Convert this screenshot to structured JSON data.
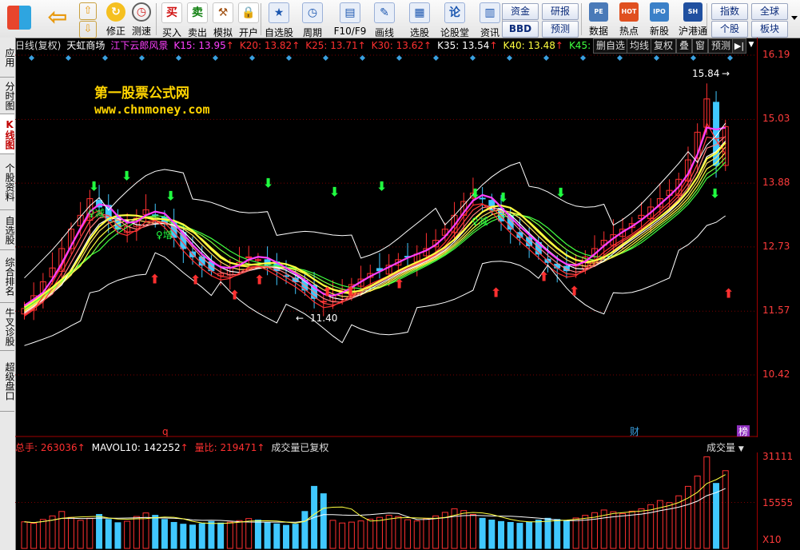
{
  "toolbar": {
    "nav": [
      {
        "label": "修正",
        "icon": "refresh-icon"
      },
      {
        "label": "测速",
        "icon": "clock-icon"
      }
    ],
    "trade": [
      {
        "label": "买入",
        "glyph": "买",
        "color": "#d01010"
      },
      {
        "label": "卖出",
        "glyph": "卖",
        "color": "#108010"
      },
      {
        "label": "模拟",
        "glyph": "⚒",
        "color": "#a05010"
      },
      {
        "label": "开户",
        "glyph": "🔒",
        "color": "#706040"
      }
    ],
    "tools": [
      {
        "label": "自选股",
        "glyph": "★"
      },
      {
        "label": "周期",
        "glyph": "◷"
      },
      {
        "label": "F10/F9",
        "glyph": "▤"
      },
      {
        "label": "画线",
        "glyph": "✎"
      },
      {
        "label": "选股",
        "glyph": "▦"
      },
      {
        "label": "论股堂",
        "glyph": "论"
      },
      {
        "label": "资讯",
        "glyph": "▥"
      }
    ],
    "buttons_mid": [
      {
        "label": "资金"
      },
      {
        "label": "研报"
      },
      {
        "label": "BBD"
      },
      {
        "label": "预测"
      }
    ],
    "apps": [
      {
        "label": "数据",
        "glyph": "PE"
      },
      {
        "label": "热点",
        "glyph": "HOT"
      },
      {
        "label": "新股",
        "glyph": "IPO"
      },
      {
        "label": "沪港通",
        "glyph": "SH"
      }
    ],
    "buttons_right": [
      {
        "label": "指数"
      },
      {
        "label": "全球"
      },
      {
        "label": "个股"
      },
      {
        "label": "板块"
      }
    ]
  },
  "left_tabs": [
    {
      "label": "应用",
      "active": false
    },
    {
      "label": "分时图",
      "active": false
    },
    {
      "label": "K线图",
      "active": true
    },
    {
      "label": "个股资料",
      "active": false
    },
    {
      "label": "自选股",
      "active": false
    },
    {
      "label": "综合排名",
      "active": false
    },
    {
      "label": "牛叉诊股",
      "active": false
    },
    {
      "label": "超级盘口",
      "active": false
    }
  ],
  "chart_header": {
    "period": "日线(复权)",
    "stock": "天虹商场",
    "indicator": "江下云郎风景",
    "ma": [
      {
        "label": "K15: 13.95",
        "color": "#ff40ff",
        "arrow": "↑"
      },
      {
        "label": "K20: 13.82",
        "color": "#ff3030",
        "arrow": "↑"
      },
      {
        "label": "K25: 13.71",
        "color": "#ff3030",
        "arrow": "↑"
      },
      {
        "label": "K30: 13.62",
        "color": "#ff3030",
        "arrow": "↑"
      },
      {
        "label": "K35: 13.54",
        "color": "#ffffff",
        "arrow": "↑"
      },
      {
        "label": "K40: 13.48",
        "color": "#ffff40",
        "arrow": "↑"
      },
      {
        "label": "K45: 13.42",
        "color": "#40ff40",
        "arrow": "↑"
      }
    ],
    "buttons": [
      "删自选",
      "均线",
      "复权",
      "叠",
      "窗",
      "预测"
    ]
  },
  "watermark": {
    "line1": "第一股票公式网",
    "line2": "www.chnmoney.com"
  },
  "price_axis": {
    "ticks": [
      "16.19",
      "15.03",
      "13.88",
      "12.73",
      "11.57",
      "10.42"
    ]
  },
  "annotations": {
    "high_label": "15.84",
    "low_label": "11.40",
    "markers": [
      "q",
      "财",
      "榜"
    ],
    "plain_marks": [
      "♀减",
      "♀减",
      "♀增"
    ]
  },
  "volume_header": {
    "items": [
      {
        "label": "总手: 263036",
        "color": "#ff3030",
        "arrow": "↑"
      },
      {
        "label": "MAVOL10: 142252",
        "color": "#ffffff",
        "arrow": "↑"
      },
      {
        "label": "量比: 219471",
        "color": "#ff3030",
        "arrow": "↑"
      },
      {
        "label": "成交量已复权",
        "color": "#dddddd",
        "arrow": ""
      }
    ],
    "selector": "成交量"
  },
  "volume_axis": {
    "ticks": [
      "31111",
      "15555",
      "X10"
    ]
  },
  "colors": {
    "up": "#ff3030",
    "down": "#40c8ff",
    "ma_pink": "#ff40ff",
    "ma_yellow": "#ffff40",
    "bband": "#ffffff"
  },
  "chart_data": {
    "type": "candlestick",
    "note": "daily K-line with Bollinger-style bands, MA ribbon and volume",
    "ylim": [
      9.5,
      16.5
    ],
    "close": [
      11.62,
      11.85,
      12.1,
      12.35,
      12.7,
      13.05,
      13.3,
      13.6,
      13.45,
      13.2,
      13.05,
      13.1,
      13.25,
      13.4,
      13.3,
      13.15,
      12.9,
      12.7,
      12.55,
      12.4,
      12.3,
      12.25,
      12.35,
      12.45,
      12.55,
      12.5,
      12.4,
      12.3,
      12.2,
      12.1,
      11.95,
      11.8,
      11.75,
      11.85,
      11.95,
      12.05,
      12.15,
      12.25,
      12.3,
      12.4,
      12.5,
      12.55,
      12.6,
      12.7,
      12.85,
      13.05,
      13.3,
      13.55,
      13.7,
      13.6,
      13.4,
      13.2,
      13.05,
      12.9,
      12.75,
      12.6,
      12.45,
      12.35,
      12.3,
      12.4,
      12.55,
      12.7,
      12.85,
      12.95,
      13.05,
      13.15,
      13.3,
      13.45,
      13.6,
      13.75,
      13.95,
      14.3,
      14.8,
      15.4,
      14.2,
      14.9
    ],
    "volume": [
      9000,
      8500,
      9800,
      11000,
      12500,
      10500,
      9500,
      10200,
      11500,
      9800,
      8700,
      9200,
      10800,
      12000,
      11200,
      9800,
      8800,
      8200,
      7900,
      8400,
      9100,
      8600,
      8900,
      9400,
      10100,
      9600,
      8800,
      8300,
      7800,
      8200,
      12500,
      21000,
      18500,
      9500,
      8600,
      8900,
      9300,
      9900,
      10500,
      11200,
      10800,
      9700,
      9300,
      10100,
      11000,
      12200,
      13400,
      12800,
      11500,
      10200,
      9600,
      9100,
      8800,
      8500,
      8900,
      9600,
      10200,
      9800,
      9400,
      10300,
      11200,
      12100,
      13000,
      12400,
      11800,
      12600,
      13400,
      14800,
      16200,
      15500,
      17800,
      21000,
      24500,
      31000,
      22000,
      26300
    ]
  }
}
